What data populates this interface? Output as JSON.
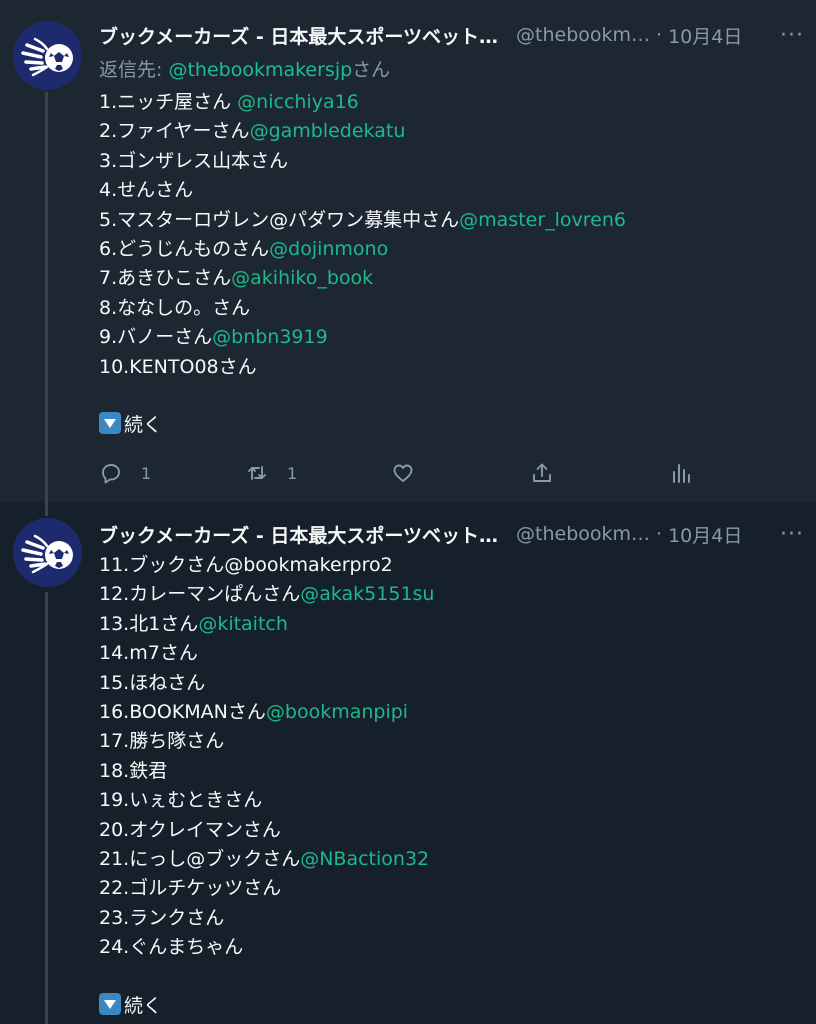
{
  "tweets": [
    {
      "author": {
        "display_name": "ブックメーカーズ - 日本最大スポーツベット…",
        "handle": "@thebookm…"
      },
      "date": "10月4日",
      "reply_to": {
        "prefix": "返信先: ",
        "handle": "@thebookmakersjp",
        "suffix": "さん"
      },
      "lines": [
        {
          "text": "1.ニッチ屋さん ",
          "mention": "@nicchiya16"
        },
        {
          "text": "2.ファイヤーさん",
          "mention": "@gambledekatu"
        },
        {
          "text": "3.ゴンザレス山本さん",
          "mention": ""
        },
        {
          "text": "4.せんさん",
          "mention": ""
        },
        {
          "text": "5.マスターロヴレン@パダワン募集中さん",
          "mention": "@master_lovren6"
        },
        {
          "text": "6.どうじんものさん",
          "mention": "@dojinmono"
        },
        {
          "text": "7.あきひこさん",
          "mention": "@akihiko_book"
        },
        {
          "text": "8.ななしの。さん",
          "mention": ""
        },
        {
          "text": "9.バノーさん",
          "mention": "@bnbn3919"
        },
        {
          "text": "10.KENTO08さん",
          "mention": ""
        }
      ],
      "continue_label": "続く",
      "actions": {
        "reply_count": "1",
        "retweet_count": "1",
        "like_count": ""
      }
    },
    {
      "author": {
        "display_name": "ブックメーカーズ - 日本最大スポーツベット…",
        "handle": "@thebookm…"
      },
      "date": "10月4日",
      "lines": [
        {
          "text": "11.ブックさん@bookmakerpro2",
          "mention": ""
        },
        {
          "text": "12.カレーマンぱんさん",
          "mention": "@akak5151su"
        },
        {
          "text": "13.北1さん",
          "mention": "@kitaitch"
        },
        {
          "text": "14.m7さん",
          "mention": ""
        },
        {
          "text": "15.ほねさん",
          "mention": ""
        },
        {
          "text": "16.BOOKMANさん",
          "mention": "@bookmanpipi"
        },
        {
          "text": "17.勝ち隊さん",
          "mention": ""
        },
        {
          "text": "18.鉄君",
          "mention": ""
        },
        {
          "text": "19.いぇむときさん",
          "mention": ""
        },
        {
          "text": "20.オクレイマンさん",
          "mention": ""
        },
        {
          "text": "21.にっし@ブックさん",
          "mention": "@NBaction32"
        },
        {
          "text": "22.ゴルチケッツさん",
          "mention": ""
        },
        {
          "text": "23.ランクさん",
          "mention": ""
        },
        {
          "text": "24.ぐんまちゃん",
          "mention": ""
        }
      ],
      "continue_label": "続く"
    }
  ],
  "ui": {
    "dot": "·",
    "more_glyph": "···"
  },
  "colors": {
    "background": "#15202b",
    "highlighted_background": "#1c2732",
    "mention": "#1db88c",
    "muted": "#8b98a5",
    "avatar_bg": "#1d2a6e"
  },
  "icons": {
    "avatar_logo": "flaming-soccer-ball-icon",
    "continue": "down-arrow-button-icon",
    "reply": "reply-icon",
    "retweet": "retweet-icon",
    "like": "heart-icon",
    "share": "share-icon",
    "stats": "analytics-icon",
    "more": "more-icon"
  }
}
